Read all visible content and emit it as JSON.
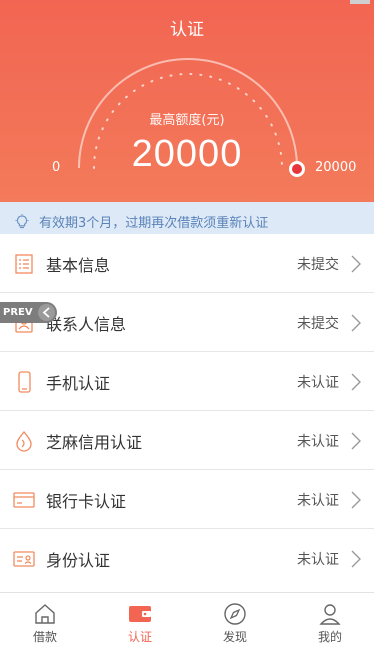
{
  "header": {
    "title": "认证"
  },
  "gauge": {
    "label": "最高额度(元)",
    "value": "20000",
    "min_label": "0",
    "max_label": "20000",
    "fill_fraction": 1.0
  },
  "notice": {
    "text": "有效期3个月，过期再次借款须重新认证"
  },
  "overlay": {
    "prev_label": "PREV"
  },
  "items": [
    {
      "label": "基本信息",
      "status": "未提交",
      "icon": "list-icon"
    },
    {
      "label": "联系人信息",
      "status": "未提交",
      "icon": "contact-icon"
    },
    {
      "label": "手机认证",
      "status": "未认证",
      "icon": "phone-icon"
    },
    {
      "label": "芝麻信用认证",
      "status": "未认证",
      "icon": "sesame-credit-icon"
    },
    {
      "label": "银行卡认证",
      "status": "未认证",
      "icon": "bank-card-icon"
    },
    {
      "label": "身份认证",
      "status": "未认证",
      "icon": "id-card-icon"
    }
  ],
  "tabs": [
    {
      "label": "借款",
      "icon": "home-icon",
      "active": false
    },
    {
      "label": "认证",
      "icon": "wallet-icon",
      "active": true
    },
    {
      "label": "发现",
      "icon": "compass-icon",
      "active": false
    },
    {
      "label": "我的",
      "icon": "user-icon",
      "active": false
    }
  ],
  "colors": {
    "brand": "#f26552",
    "notice_bg": "#dde9f6",
    "notice_text": "#5a83b8",
    "icon_stroke": "#f08a5d"
  }
}
